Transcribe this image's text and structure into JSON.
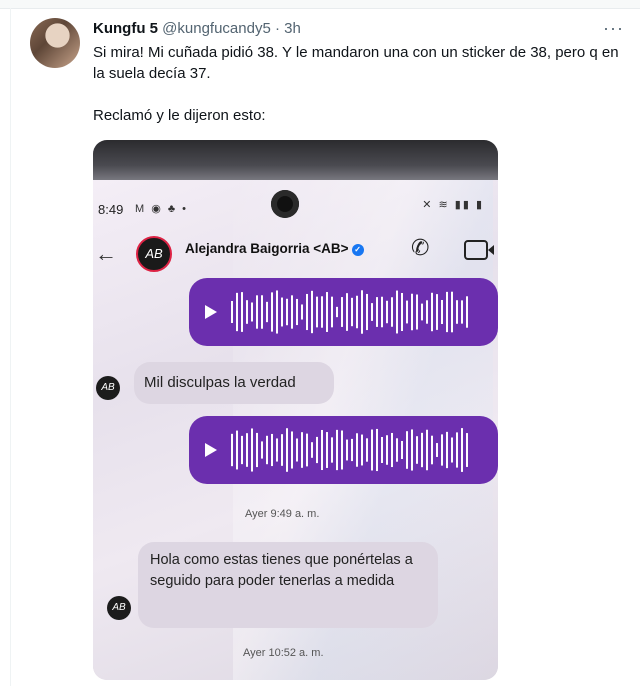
{
  "tweet": {
    "display_name": "Kungfu 5",
    "handle": "@kungfucandy5",
    "separator": "·",
    "time": "3h",
    "more_label": "···",
    "text_line1": "Si mira! Mi cuñada pidió 38. Y le mandaron una con un sticker de 38, pero q en la suela decía 37.",
    "text_line2": "Reclamó y le dijeron esto:"
  },
  "photo": {
    "status_time": "8:49",
    "status_left_icons": "M ◉ ♣ •",
    "status_right_icons": "✕ ≋ ▮▮ ▮",
    "chat_avatar_initials": "AB",
    "chat_name": "Alejandra Baigorria <AB>",
    "verified_mark": "✓",
    "messages": {
      "text1": "Mil disculpas la verdad",
      "time1": "Ayer 9:49 a. m.",
      "text2": "Hola como estas tienes que ponértelas a   seguido para  poder tenerlas a medida",
      "time2": "Ayer 10:52 a. m."
    }
  },
  "colors": {
    "voice_bubble": "#6b2fae",
    "received_bubble": "#ddd6e2",
    "verified_blue": "#1877f2"
  }
}
